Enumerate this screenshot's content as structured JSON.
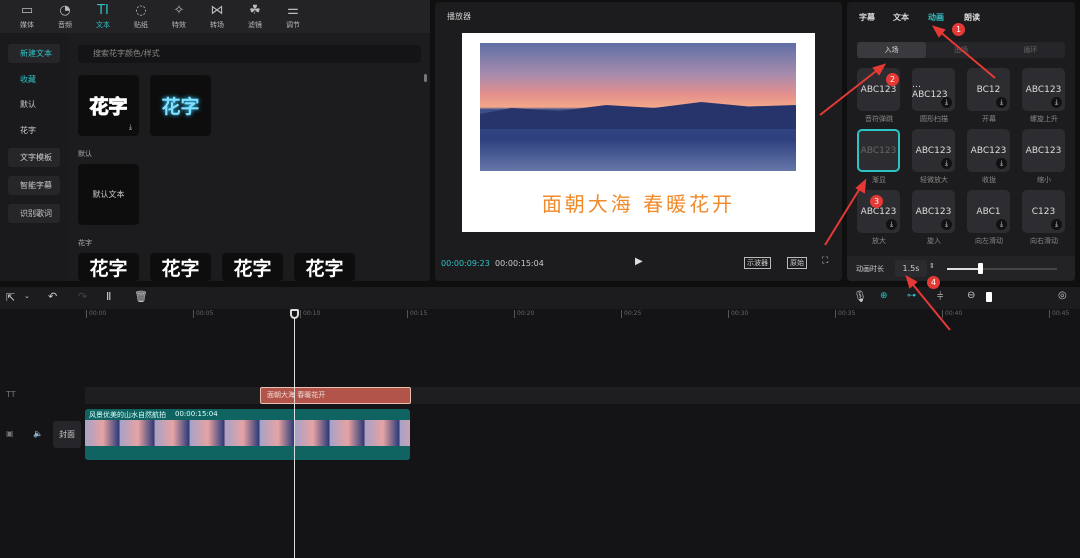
{
  "toolbar": {
    "items": [
      {
        "label": "媒体",
        "icon": "▭"
      },
      {
        "label": "音频",
        "icon": "◔"
      },
      {
        "label": "文本",
        "icon": "TI"
      },
      {
        "label": "贴纸",
        "icon": "◌"
      },
      {
        "label": "特效",
        "icon": "✧"
      },
      {
        "label": "转场",
        "icon": "⋈"
      },
      {
        "label": "滤镜",
        "icon": "☘"
      },
      {
        "label": "调节",
        "icon": "⚌"
      }
    ],
    "active": "文本"
  },
  "sidebar": {
    "items": [
      "新建文本",
      "收藏",
      "默认",
      "花字",
      "文字模板",
      "智能字幕",
      "识别歌词"
    ]
  },
  "library": {
    "search_placeholder": "搜索花字颜色/样式",
    "favorite_cards": [
      "花字",
      "花字"
    ],
    "section_default": "默认",
    "default_card": "默认文本",
    "section_huazi": "花字",
    "huazi_cards": [
      "花字",
      "花字",
      "花字",
      "花字"
    ]
  },
  "player": {
    "title": "播放器",
    "caption": "面朝大海 春暖花开",
    "current_time": "00:00:09:23",
    "total_time": "00:00:15:04",
    "btn_scope": "示波器",
    "btn_original": "原始"
  },
  "inspector": {
    "tabs": [
      "字幕",
      "文本",
      "动画",
      "朗读"
    ],
    "active_tab": "动画",
    "subtabs": [
      "入场",
      "出场",
      "循环"
    ],
    "active_subtab": "入场",
    "animations": [
      {
        "preview": "ABC123",
        "label": "音符弹跳"
      },
      {
        "preview": "…ABC123",
        "label": "圆形扫描"
      },
      {
        "preview": "BC12",
        "label": "开幕"
      },
      {
        "preview": "ABC123",
        "label": "螺旋上升"
      },
      {
        "preview": "ABC123",
        "label": "渐显",
        "selected": true
      },
      {
        "preview": "ABC123",
        "label": "轻微放大"
      },
      {
        "preview": "ABC123",
        "label": "收拢"
      },
      {
        "preview": "ABC123",
        "label": "缩小"
      },
      {
        "preview": "ABC123",
        "label": "放大"
      },
      {
        "preview": "ABC123",
        "label": "旋入"
      },
      {
        "preview": "ABC1",
        "label": "向左滑动"
      },
      {
        "preview": "C123",
        "label": "向右滑动"
      }
    ],
    "duration_label": "动画时长",
    "duration_value": "1.5s",
    "duration_fraction": 0.3
  },
  "timeline": {
    "ruler": [
      "00:00",
      "00:05",
      "00:10",
      "00:15",
      "00:20",
      "00:25",
      "00:30",
      "00:35",
      "00:40",
      "00:45"
    ],
    "text_clip": "面朝大海 春暖花开",
    "video_clip_name": "风景优美的山水自然航拍",
    "video_clip_duration": "00:00:15:04",
    "cover_label": "封面"
  },
  "annotations": [
    "1",
    "2",
    "3",
    "4"
  ],
  "colors": {
    "accent": "#2fc3c6",
    "text_clip": "#b2544a",
    "video_clip": "#0f6461",
    "annotation": "#e53935"
  }
}
